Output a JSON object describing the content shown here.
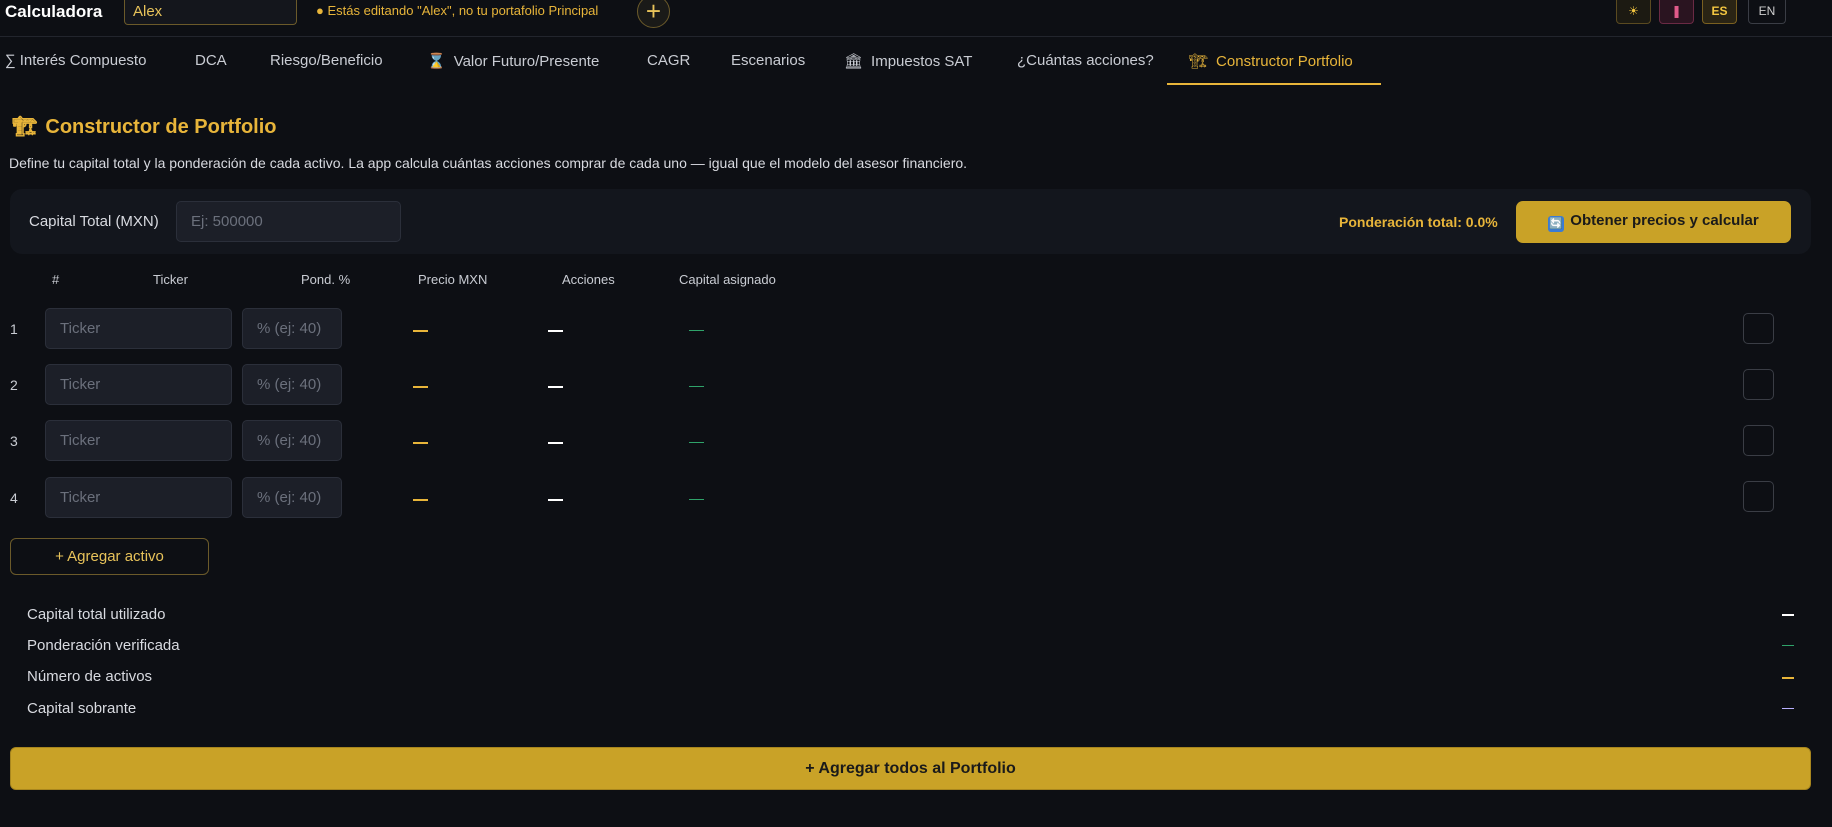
{
  "app": {
    "title": "Calculadora",
    "portfolio_name": "Alex",
    "edit_notice": "● Estás editando \"Alex\", no tu portafolio Principal",
    "add_portfolio_glyph": "+",
    "theme_icon": "☀",
    "pink_icon": "❚",
    "lang_es": "ES",
    "lang_en": "EN"
  },
  "tabs": [
    {
      "icon": "∑",
      "label": "Interés Compuesto"
    },
    {
      "icon": "",
      "label": "DCA"
    },
    {
      "icon": "",
      "label": "Riesgo/Beneficio"
    },
    {
      "icon": "⌛",
      "label": "Valor Futuro/Presente"
    },
    {
      "icon": "",
      "label": "CAGR"
    },
    {
      "icon": "",
      "label": "Escenarios"
    },
    {
      "icon": "🏛",
      "label": "Impuestos SAT"
    },
    {
      "icon": "",
      "label": "¿Cuántas acciones?"
    },
    {
      "icon": "🏗",
      "label": "Constructor Portfolio"
    }
  ],
  "header": {
    "icon": "🏗",
    "title": "Constructor de Portfolio",
    "description": "Define tu capital total y la ponderación de cada activo. La app calcula cuántas acciones comprar de cada uno — igual que el modelo del asesor financiero."
  },
  "capital": {
    "label": "Capital Total (MXN)",
    "placeholder": "Ej: 500000",
    "weight_total": "Ponderación total: 0.0%",
    "calc_icon": "🔄",
    "calc_button": "Obtener precios y calcular"
  },
  "table": {
    "headers": [
      "#",
      "Ticker",
      "Pond. %",
      "Precio MXN",
      "Acciones",
      "Capital asignado"
    ],
    "ticker_placeholder": "Ticker",
    "pond_placeholder": "% (ej: 40)",
    "rows": [
      {
        "num": "1"
      },
      {
        "num": "2"
      },
      {
        "num": "3"
      },
      {
        "num": "4"
      }
    ]
  },
  "add_asset": "+ Agregar activo",
  "summary": [
    {
      "label": "Capital total utilizado",
      "color": "#ffffff"
    },
    {
      "label": "Ponderación verificada",
      "color": "#2fa36a"
    },
    {
      "label": "Número de activos",
      "color": "#e8b53a"
    },
    {
      "label": "Capital sobrante",
      "color": "#b8b0ff"
    }
  ],
  "add_all": "+ Agregar todos al Portfolio",
  "colors": {
    "accent": "#e8b53a",
    "button_gold": "#c9a227",
    "background": "#0d0f14"
  }
}
